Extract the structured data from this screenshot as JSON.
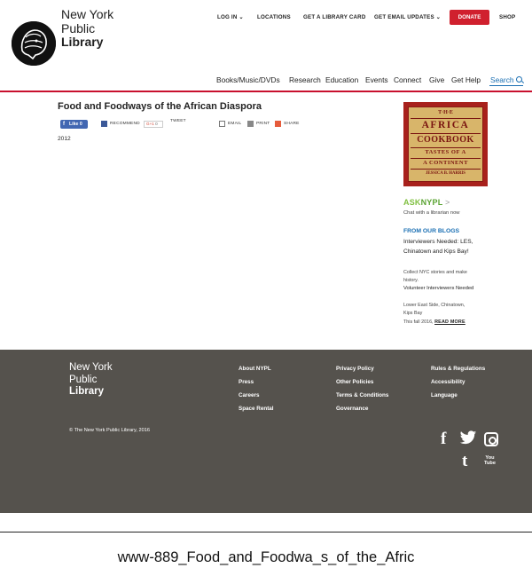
{
  "header": {
    "logo": {
      "line1": "New York",
      "line2": "Public",
      "line3": "Library"
    },
    "util_nav": {
      "login": "LOG IN",
      "locations": "LOCATIONS",
      "library_card": "GET A LIBRARY CARD",
      "email_updates": "GET EMAIL UPDATES",
      "donate": "DONATE",
      "shop": "SHOP"
    },
    "main_nav": [
      "Books/Music/DVDs",
      "Research",
      "Education",
      "Events",
      "Connect",
      "Give",
      "Get Help"
    ],
    "search_label": "Search"
  },
  "content": {
    "title": "Food and Foodways of the African Diaspora",
    "share": {
      "like": "Like 0",
      "recommend": "RECOMMEND",
      "gplus": "G+1",
      "gplus_count": "0",
      "tweet": "TWEET",
      "email": "EMAIL",
      "print": "PRINT",
      "share": "SHARE"
    },
    "year": "2012"
  },
  "sidebar": {
    "book": {
      "line1": "T·H·E",
      "line2": "AFRICA",
      "line3": "COOKBOOK",
      "line4": "TASTES OF A",
      "line5": "A CONTINENT",
      "line6": "JESSICA B. HARRIS"
    },
    "ask": {
      "part1": "ASK",
      "part2": "NYPL",
      "arrow": ">"
    },
    "ask_sub": "Chat with a librarian now",
    "blogs_heading": "FROM OUR BLOGS",
    "blog1_title": "Interviewers Needed: LES, Chinatown and Kips Bay!",
    "blog1_text": "Collect NYC stories and make history.",
    "blog2_title": "Volunteer Interviewers Needed",
    "blog2_text": "Lower East Side, Chinatown, Kips Bay",
    "blog2_extra": "This fall 2016,",
    "read_more": "READ MORE"
  },
  "footer": {
    "logo": {
      "line1": "New York",
      "line2": "Public",
      "line3": "Library"
    },
    "col1": [
      "About NYPL",
      "Press",
      "Careers",
      "Space Rental"
    ],
    "col2": [
      "Privacy Policy",
      "Other Policies",
      "Terms & Conditions",
      "Governance"
    ],
    "col3": [
      "Rules & Regulations",
      "Accessibility",
      "Language"
    ],
    "copyright": "© The New York Public Library, 2016",
    "youtube_top": "You",
    "youtube_bottom": "Tube"
  },
  "caption": "www-889_Food_and_Foodwa_s_of_the_Afric",
  "colors": {
    "accent_red": "#d0202e",
    "link_blue": "#1a6fb3",
    "footer_bg": "#55524d",
    "ask_green": "#7fbf3f"
  }
}
